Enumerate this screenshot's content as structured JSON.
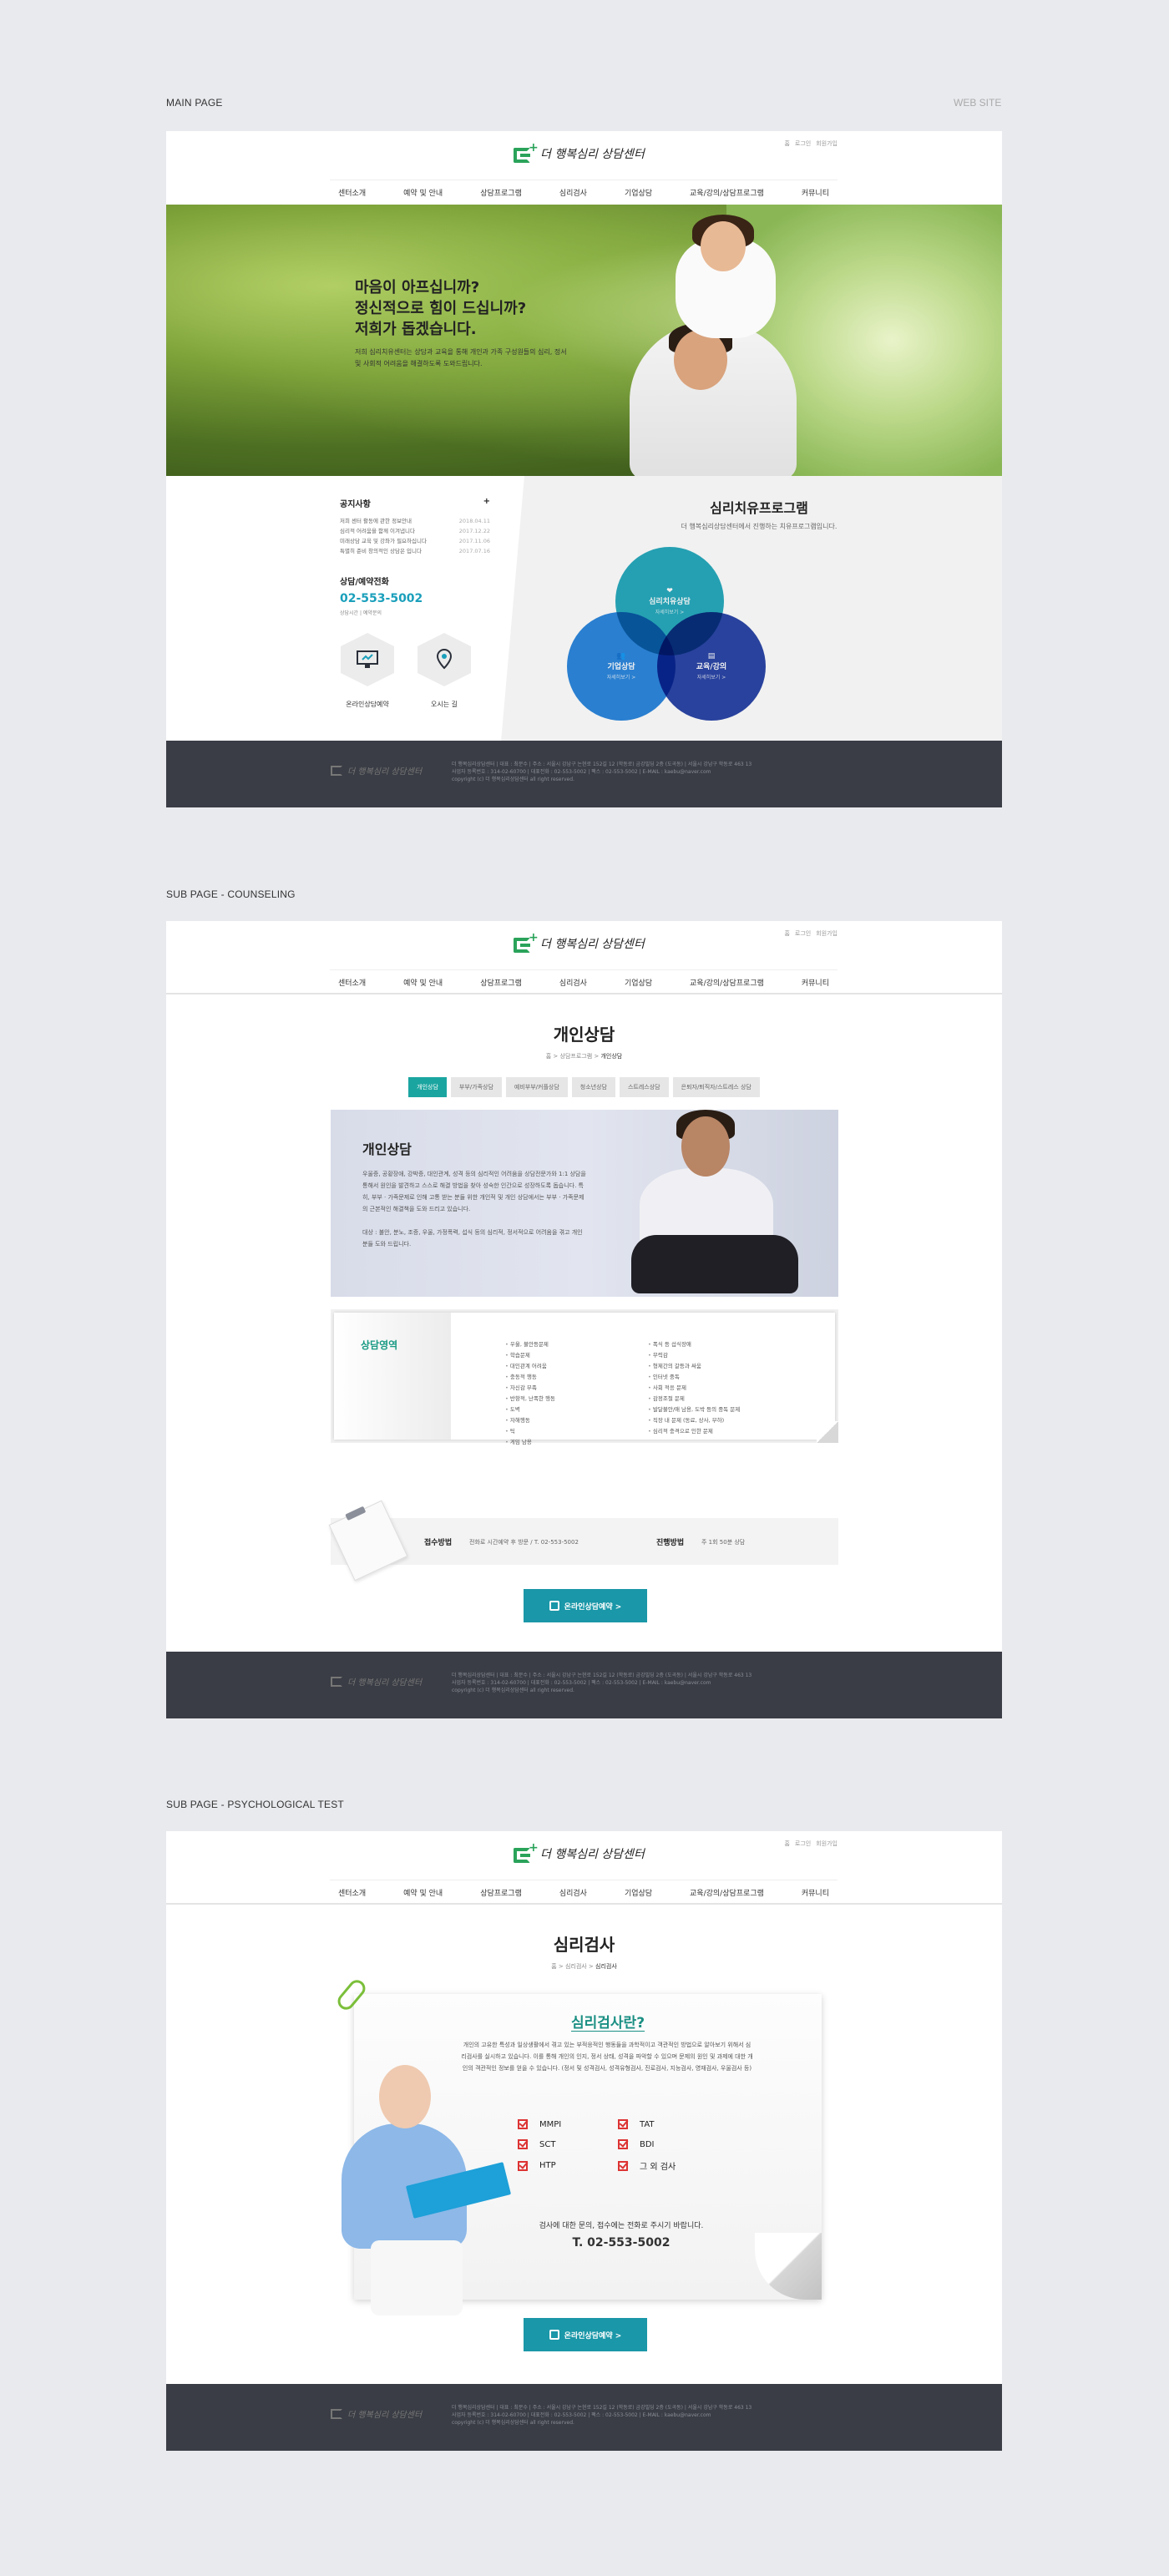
{
  "labels": {
    "main": "MAIN PAGE",
    "website": "WEB SITE",
    "sub_counseling": "SUB PAGE - COUNSELING",
    "sub_test": "SUB PAGE - PSYCHOLOGICAL TEST"
  },
  "header": {
    "util": [
      "홈",
      "로그인",
      "회원가입"
    ],
    "logo_text": "더 행복심리 상담센터",
    "nav": [
      "센터소개",
      "예약 및 안내",
      "상담프로그램",
      "심리검사",
      "기업상담",
      "교육/강의/상담프로그램",
      "커뮤니티"
    ]
  },
  "main": {
    "hero": {
      "line1": "마음이 아프십니까?",
      "line2": "정신적으로 힘이 드십니까?",
      "line3": "저희가 돕겠습니다.",
      "desc": "저희 심리치유센터는 상담과 교육을 통해 개인과 가족 구성원들의 심리, 정서 및 사회적 어려움을 해결하도록 도와드립니다."
    },
    "notice": {
      "title": "공지사항",
      "more": "+",
      "items": [
        {
          "t": "저희 센터 활동에 관한 정보안내",
          "d": "2018.04.11"
        },
        {
          "t": "심리적 어려움을 함께 이겨냅니다",
          "d": "2017.12.22"
        },
        {
          "t": "미래상담 교육 및 강좌가 필요하십니다",
          "d": "2017.11.06"
        },
        {
          "t": "특별히 준비 창의적인 상담은 입니다",
          "d": "2017.07.16"
        }
      ]
    },
    "phone": {
      "title": "상담/예약전화",
      "number": "02-553-5002",
      "sub": "상담시간 | 예약문의"
    },
    "buttons": {
      "online": "온라인상담예약",
      "map": "오시는 길"
    },
    "program": {
      "title": "심리치유프로그램",
      "sub": "더 행복심리상담센터에서 진행하는 치유프로그램입니다.",
      "c1": "심리치유상담",
      "c1s": "자세히보기 >",
      "c2": "기업상담",
      "c2s": "자세히보기 >",
      "c3": "교육/강의",
      "c3s": "자세히보기 >"
    }
  },
  "footer": {
    "logo": "더 행복심리 상담센터",
    "line1": "더 행복심리상담센터 | 대표 : 최문수 | 주소 : 서울시 강남구 논현로 152길 12 (학동로) 금강빌딩 2층 (도곡동) | 서울시 강남구 학동로 463 13",
    "line2": "사업자 등록번호 : 314-02-60700 | 대표전화 : 02-553-5002 | 팩스 : 02-553-5002 | E-MAIL : kaebu@naver.com",
    "line3": "copyright (c) 더 행복심리상담센터 all right reserved."
  },
  "counseling": {
    "title": "개인상담",
    "breadcrumb": "홈 > 상담프로그램 >",
    "breadcrumb_current": "개인상담",
    "tabs": [
      "개인상담",
      "부부/가족상담",
      "예비부부/커플상담",
      "청소년상담",
      "스트레스상담",
      "은퇴자/퇴직자/스트레스 상담"
    ],
    "banner_title": "개인상담",
    "banner_p1": "우울증, 공황장애, 강박증, 대인관계, 성격 등의 심리적인 어려움을 상담전문가와 1:1 상담을 통해서 원인을 발견하고 스스로 해결 방법을 찾아 성숙한 인간으로 성장하도록 돕습니다. 특히, 부부 · 가족문제로 인해 고통 받는 분들 위한 개인적 및 개인 상담에서는 부부 · 가족문제의 근본적인 해결책을 도와 드리고 있습니다.",
    "banner_p2": "대상 : 불안, 분노, 조증, 우울, 가정폭력, 섭식 등의 심리적, 정서적으로 어려움을 겪고 개인 분들 도와 드립니다.",
    "area_title": "상담영역",
    "col1": [
      "우울, 불안등문제",
      "학습문제",
      "대인관계 어려움",
      "충동적 행동",
      "자신감 부족",
      "반항적, 난폭한 행동",
      "도벽",
      "자해행동",
      "틱",
      "게임 남용"
    ],
    "col2": [
      "폭식 등 섭식장애",
      "무력감",
      "형제간의 갈등과 싸움",
      "인터넷 중독",
      "사회 적응 문제",
      "감정조절 문제",
      "발달불안/애 남용, 도박 등의 중독 문제",
      "직장 내 문제 (동료, 상사, 부하)",
      "심리적 충격으로 인한 문제"
    ],
    "receipt_label": "접수방법",
    "receipt_value": "전화로 시간예약 후 방문 / T. 02-553-5002",
    "proceed_label": "진행방법",
    "proceed_value": "주 1회 50분 상담",
    "book_button": "온라인상담예약 >"
  },
  "test": {
    "title": "심리검사",
    "breadcrumb": "홈 > 심리검사 >",
    "breadcrumb_current": "심리검사",
    "paper_title": "심리검사란?",
    "desc": "개인의 고유한 특성과 일상생활에서 겪고 있는 부적응적인 행동들을 과학적이고 객관적인 방법으로 알아보기 위해서 심리검사를 실시하고 있습니다. 이를 통해 개인의 인지, 정서 상태, 성격을 파악할 수 있으며 문제의 원인 및 과제에 대한 개인의 객관적인 정보를 얻을 수 있습니다. (정서 및 성격검사, 성격유형검사, 진로검사, 지능검사, 영재검사, 우울검사 등)",
    "checks": [
      "MMPI",
      "TAT",
      "SCT",
      "BDI",
      "HTP",
      "그 외 검사"
    ],
    "ask": "검사에 대한 문의, 접수에는 전화로 주시기 바랍니다.",
    "tel": "T. 02-553-5002",
    "book_button": "온라인상담예약 >"
  }
}
